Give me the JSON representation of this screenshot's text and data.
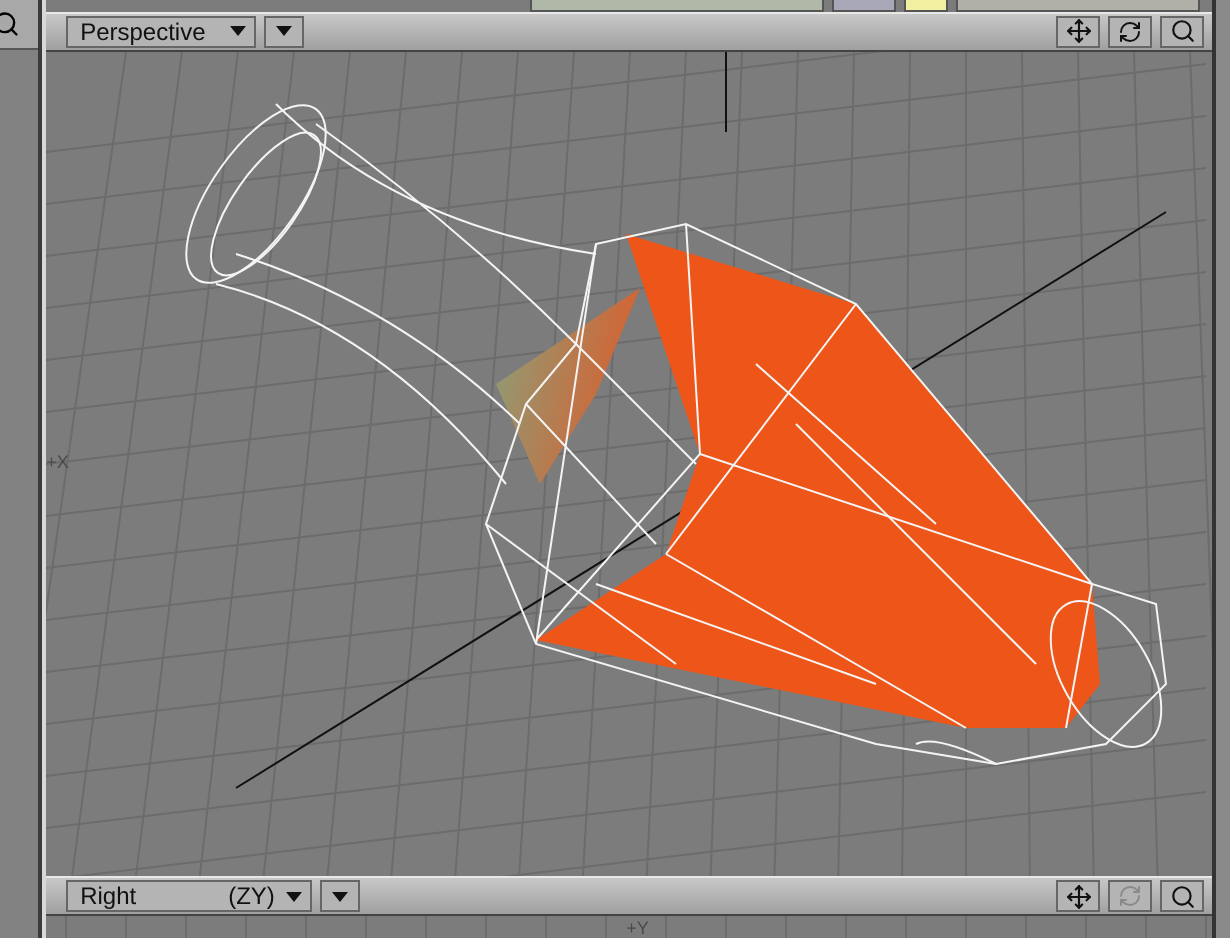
{
  "viewports": [
    {
      "view": "Perspective",
      "rotate_enabled": true,
      "axis_labels": [
        "+X"
      ]
    },
    {
      "view": "Right",
      "axes": "(ZY)",
      "rotate_enabled": false,
      "axis_labels": [
        "+Y"
      ]
    }
  ]
}
